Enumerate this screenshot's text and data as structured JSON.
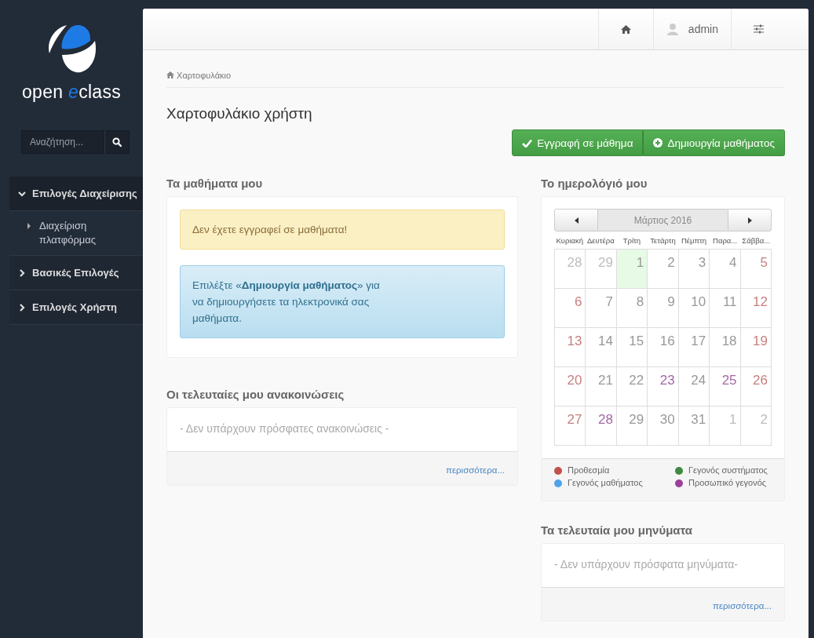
{
  "sidebar": {
    "logo": {
      "word_1": "open",
      "word_2_accent": "e",
      "word_2_rest": "class"
    },
    "search": {
      "placeholder": "Αναζήτηση..."
    },
    "menu": [
      {
        "label": "Επιλογές Διαχείρισης",
        "expanded": true,
        "children": [
          {
            "label": "Διαχείριση πλατφόρμας"
          }
        ]
      },
      {
        "label": "Βασικές Επιλογές",
        "expanded": false
      },
      {
        "label": "Επιλογές Χρήστη",
        "expanded": false
      }
    ]
  },
  "header": {
    "user": "admin"
  },
  "breadcrumb": "Χαρτοφυλάκιο",
  "page_title": "Χαρτοφυλάκιο χρήστη",
  "actions": [
    {
      "kind": "check",
      "label": "Εγγραφή σε μάθημα"
    },
    {
      "kind": "plus",
      "label": "Δημιουργία μαθήματος"
    }
  ],
  "my_courses": {
    "title": "Τα μαθήματα μου",
    "alerts": [
      {
        "kind": "warning",
        "text": "Δεν έχετε εγγραφεί σε μαθήματα!"
      },
      {
        "kind": "info",
        "text": "Επιλέξτε «**Δημιουργία μαθήματος**» για να δημιουργήσετε τα ηλεκτρονικά σας μαθήματα."
      }
    ]
  },
  "announcements": {
    "title": "Οι τελευταίες μου ανακοινώσεις",
    "empty": "- Δεν υπάρχουν πρόσφατες ανακοινώσεις -",
    "more": "περισσότερα..."
  },
  "calendar": {
    "title": "Το ημερολόγιό μου",
    "month": "Μάρτιος 2016",
    "weekdays": [
      "Κυριακή",
      "Δευτέρα",
      "Τρίτη",
      "Τετάρτη",
      "Πέμπτη",
      "Παρα...",
      "Σάββα..."
    ],
    "days": [
      {
        "text": "28",
        "kind": "other",
        "today": false
      },
      {
        "text": "29",
        "kind": "other",
        "today": false
      },
      {
        "text": "1",
        "kind": "weekday",
        "today": true
      },
      {
        "text": "2",
        "kind": "weekday",
        "today": false
      },
      {
        "text": "3",
        "kind": "weekday",
        "today": false
      },
      {
        "text": "4",
        "kind": "weekday",
        "today": false
      },
      {
        "text": "5",
        "kind": "weekend",
        "today": false
      },
      {
        "text": "6",
        "kind": "weekend",
        "today": false
      },
      {
        "text": "7",
        "kind": "weekday",
        "today": false
      },
      {
        "text": "8",
        "kind": "weekday",
        "today": false
      },
      {
        "text": "9",
        "kind": "weekday",
        "today": false
      },
      {
        "text": "10",
        "kind": "weekday",
        "today": false
      },
      {
        "text": "11",
        "kind": "weekday",
        "today": false
      },
      {
        "text": "12",
        "kind": "weekend",
        "today": false
      },
      {
        "text": "13",
        "kind": "weekend",
        "today": false
      },
      {
        "text": "14",
        "kind": "weekday",
        "today": false
      },
      {
        "text": "15",
        "kind": "weekday",
        "today": false
      },
      {
        "text": "16",
        "kind": "weekday",
        "today": false
      },
      {
        "text": "17",
        "kind": "weekday",
        "today": false
      },
      {
        "text": "18",
        "kind": "weekday",
        "today": false
      },
      {
        "text": "19",
        "kind": "weekend",
        "today": false
      },
      {
        "text": "20",
        "kind": "weekend",
        "today": false
      },
      {
        "text": "21",
        "kind": "weekday",
        "today": false
      },
      {
        "text": "22",
        "kind": "weekday",
        "today": false
      },
      {
        "text": "23",
        "kind": "event",
        "today": false
      },
      {
        "text": "24",
        "kind": "weekday",
        "today": false
      },
      {
        "text": "25",
        "kind": "event",
        "today": false
      },
      {
        "text": "26",
        "kind": "weekend",
        "today": false
      },
      {
        "text": "27",
        "kind": "weekend",
        "today": false
      },
      {
        "text": "28",
        "kind": "event",
        "today": false
      },
      {
        "text": "29",
        "kind": "weekday",
        "today": false
      },
      {
        "text": "30",
        "kind": "weekday",
        "today": false
      },
      {
        "text": "31",
        "kind": "weekday",
        "today": false
      },
      {
        "text": "1",
        "kind": "other",
        "today": false
      },
      {
        "text": "2",
        "kind": "other",
        "today": false
      }
    ],
    "legend": [
      {
        "label": "Προθεσμία",
        "color": "#c0504d"
      },
      {
        "label": "Γεγονός μαθήματος",
        "color": "#4fa3e8"
      },
      {
        "label": "Γεγονός συστήματος",
        "color": "#3f8a3f"
      },
      {
        "label": "Προσωπικό γεγονός",
        "color": "#9b3f9b"
      }
    ]
  },
  "messages": {
    "title": "Τα τελευταία μου μηνύματα",
    "empty": "- Δεν υπάρχουν πρόσφατα μηνύματα-",
    "more": "περισσότερα..."
  }
}
